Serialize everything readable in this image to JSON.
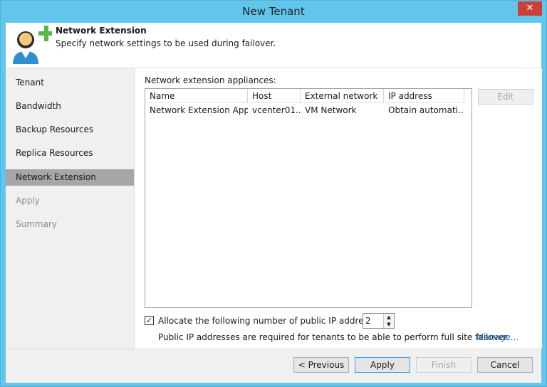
{
  "window": {
    "title": "New Tenant",
    "close_glyph": "✕"
  },
  "header": {
    "title": "Network Extension",
    "subtitle": "Specify network settings to be used during failover.",
    "icon": "tenant-add-icon"
  },
  "sidebar": {
    "items": [
      {
        "label": "Tenant",
        "state": "normal"
      },
      {
        "label": "Bandwidth",
        "state": "normal"
      },
      {
        "label": "Backup Resources",
        "state": "normal"
      },
      {
        "label": "Replica Resources",
        "state": "normal"
      },
      {
        "label": "Network Extension",
        "state": "active"
      },
      {
        "label": "Apply",
        "state": "disabled"
      },
      {
        "label": "Summary",
        "state": "disabled"
      }
    ]
  },
  "main": {
    "section_label": "Network extension appliances:",
    "table": {
      "columns": [
        "Name",
        "Host",
        "External network",
        "IP address"
      ],
      "rows": [
        [
          "Network Extension App...",
          "vcenter01...",
          "VM Network",
          "Obtain automati..."
        ]
      ]
    },
    "edit_button": "Edit",
    "allocate_checkbox": {
      "label": "Allocate the following number of public IP addresses:",
      "checked": true,
      "glyph": "✓"
    },
    "ip_count": "2",
    "spinner_up": "▲",
    "spinner_down": "▼",
    "note": "Public IP addresses are required for tenants to be able to perform full site failover.",
    "manage_link": "Manage..."
  },
  "footer": {
    "previous": "< Previous",
    "apply": "Apply",
    "finish": "Finish",
    "cancel": "Cancel"
  },
  "colors": {
    "title_bar": "#62c6ec",
    "active_nav": "#a6a6a6",
    "link": "#1f6fc4",
    "close": "#c9403a"
  }
}
